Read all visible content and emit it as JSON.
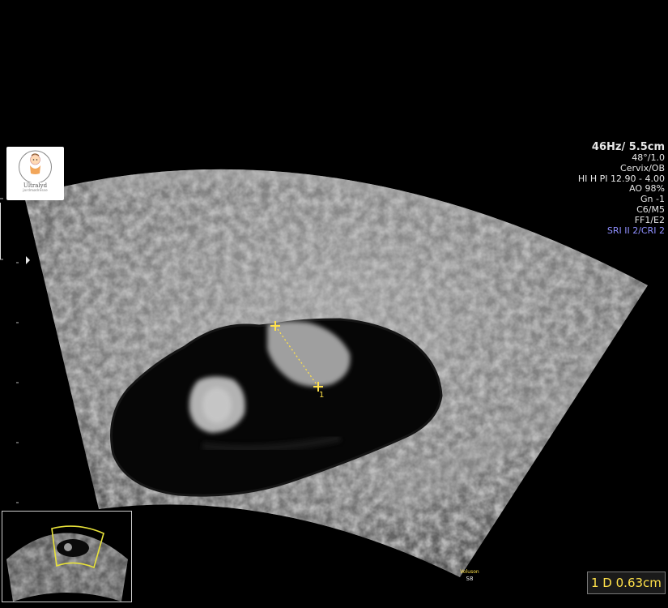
{
  "parameters": [
    "46Hz/ 5.5cm",
    "48°/1.0",
    "Cervix/OB",
    "HI H PI 12.90 - 4.00",
    "AO 98%",
    "Gn  -1",
    "C6/M5",
    "FF1/E2",
    "SRI II 2/CRI 2"
  ],
  "logo": {
    "name": "Ultralyd",
    "sub": "jordmødresse"
  },
  "measurement": {
    "label": "1 D 0.63cm",
    "caliper_label": "1"
  },
  "brand": {
    "line1": "Voluson",
    "line2": "S8"
  },
  "icons": {
    "logo": "baby-face-icon",
    "depth_marker": "triangle-right-icon",
    "caliper": "crosshair-icon"
  },
  "colors": {
    "caliper": "#ffe14a",
    "highlight_param": "#8f8fff",
    "background": "#000000"
  }
}
